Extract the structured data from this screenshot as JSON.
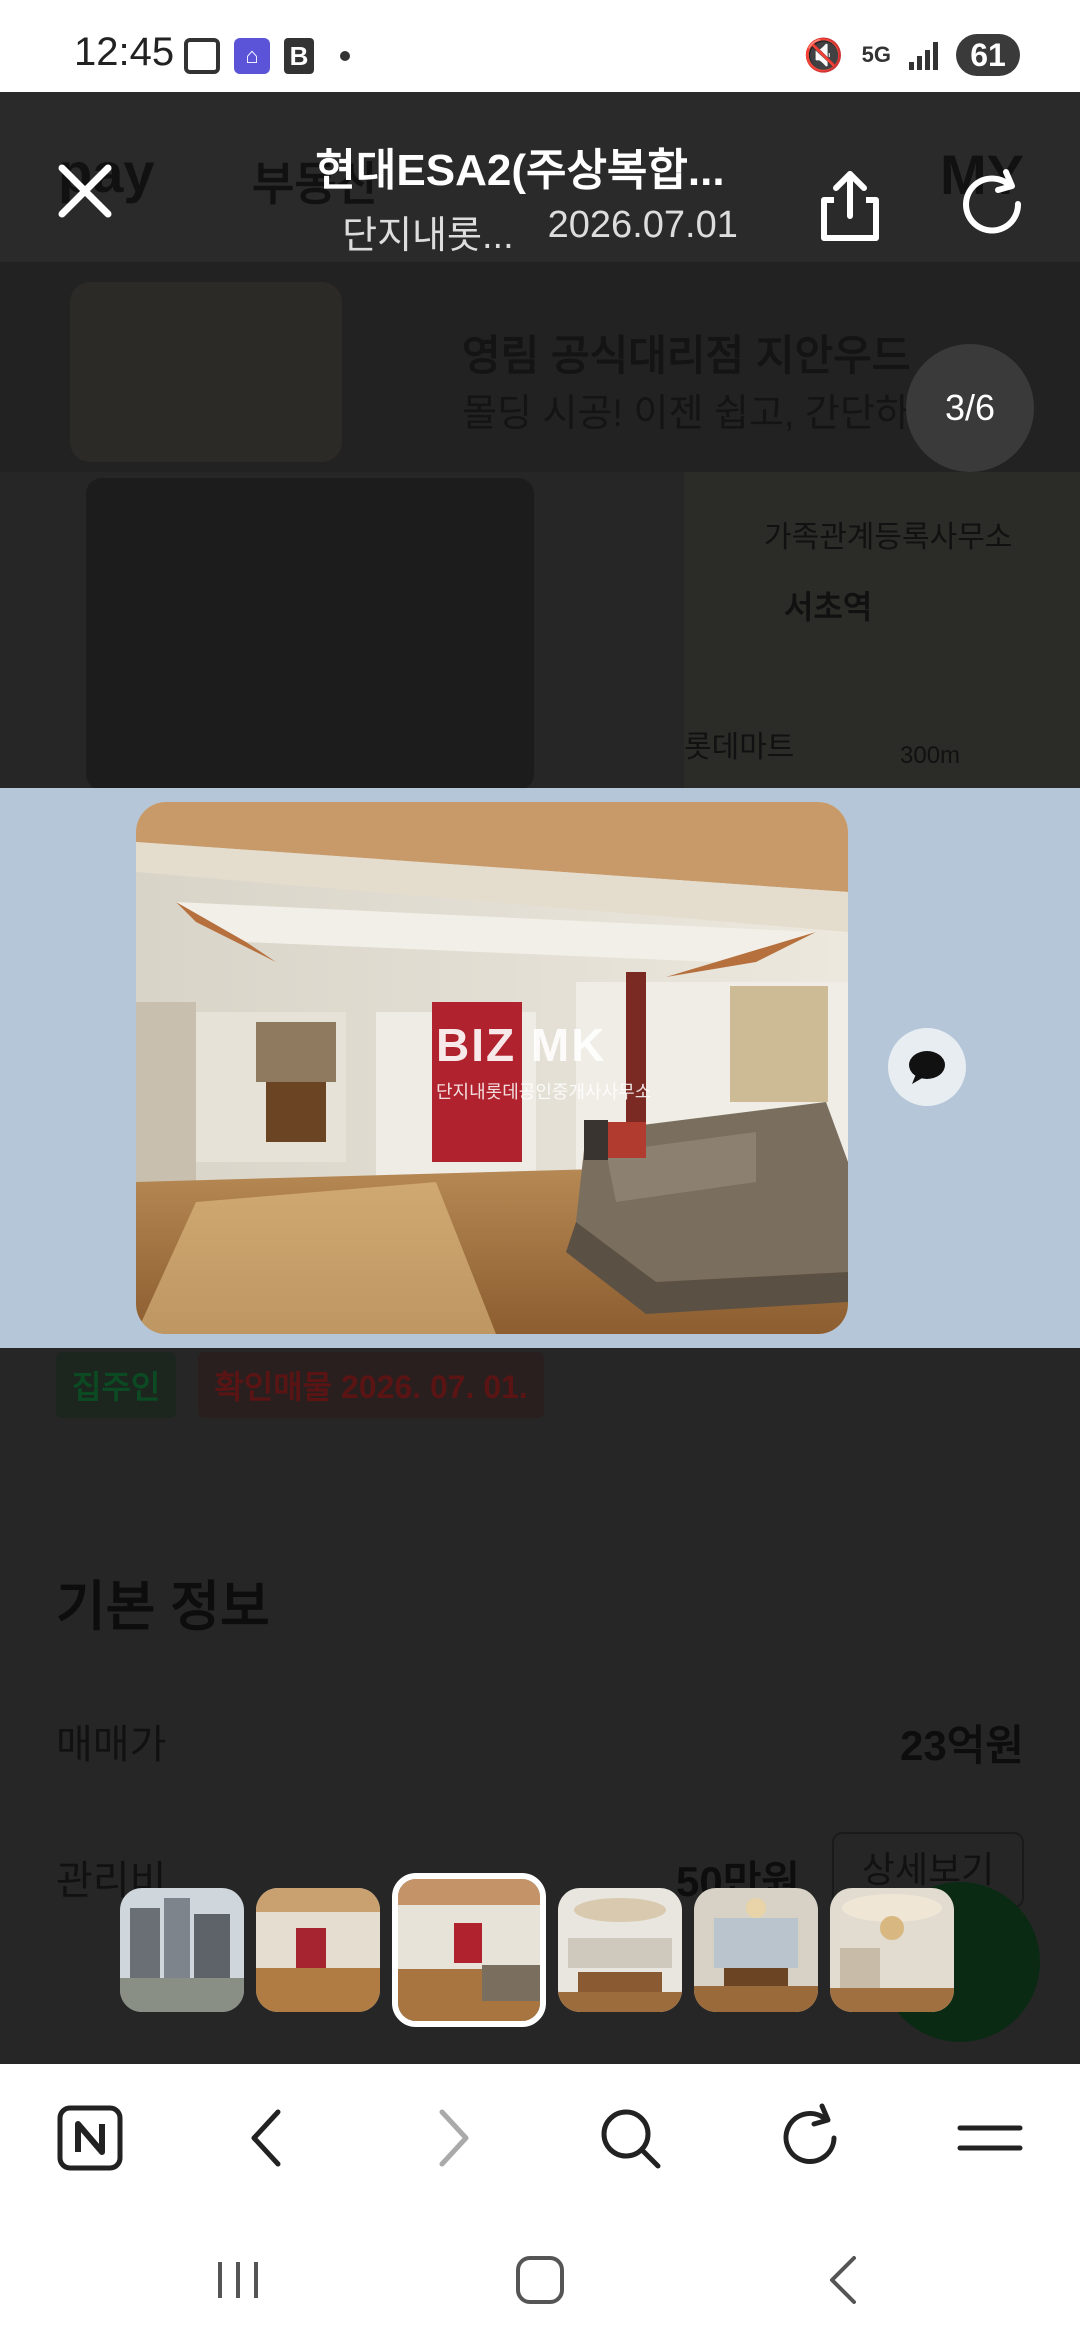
{
  "status_bar": {
    "time": "12:45",
    "network": "5G",
    "battery": "61"
  },
  "backdrop": {
    "logo": "pay",
    "service": "부동산",
    "my": "MY",
    "ad_title": "영림 공식대리점 지안우드",
    "ad_subtitle": "몰딩 시공! 이젠 쉽고, 간단하게",
    "map_labels": [
      "가족관계등록사무소",
      "서초역",
      "롯데마트",
      "300m"
    ],
    "tag_owner": "집주인",
    "tag_confirm": "확인매물 2026. 07. 01.",
    "section_title": "기본 정보",
    "price_label": "매매가",
    "price_value": "23억원",
    "fee_label": "관리비",
    "fee_value": "50만원",
    "fee_button": "상세보기"
  },
  "viewer": {
    "title": "현대ESA2(주상복합...",
    "agency": "단지내롯...",
    "date": "2026.07.01",
    "counter": "3/6",
    "watermark": "BIZ MK",
    "watermark_sub": "단지내롯데공인중개사사무소"
  },
  "thumbnails": [
    {
      "name": "thumb-building",
      "active": false
    },
    {
      "name": "thumb-living-room-1",
      "active": false
    },
    {
      "name": "thumb-living-room-2",
      "active": true
    },
    {
      "name": "thumb-kitchen",
      "active": false
    },
    {
      "name": "thumb-dining",
      "active": false
    },
    {
      "name": "thumb-hall",
      "active": false
    }
  ],
  "browser_nav": {
    "icons": [
      "naver-home-icon",
      "back-arrow-icon",
      "forward-arrow-icon",
      "search-icon",
      "reload-icon",
      "menu-icon"
    ]
  },
  "colors": {
    "band": "#b4c6d8",
    "backdrop": "#262626"
  }
}
